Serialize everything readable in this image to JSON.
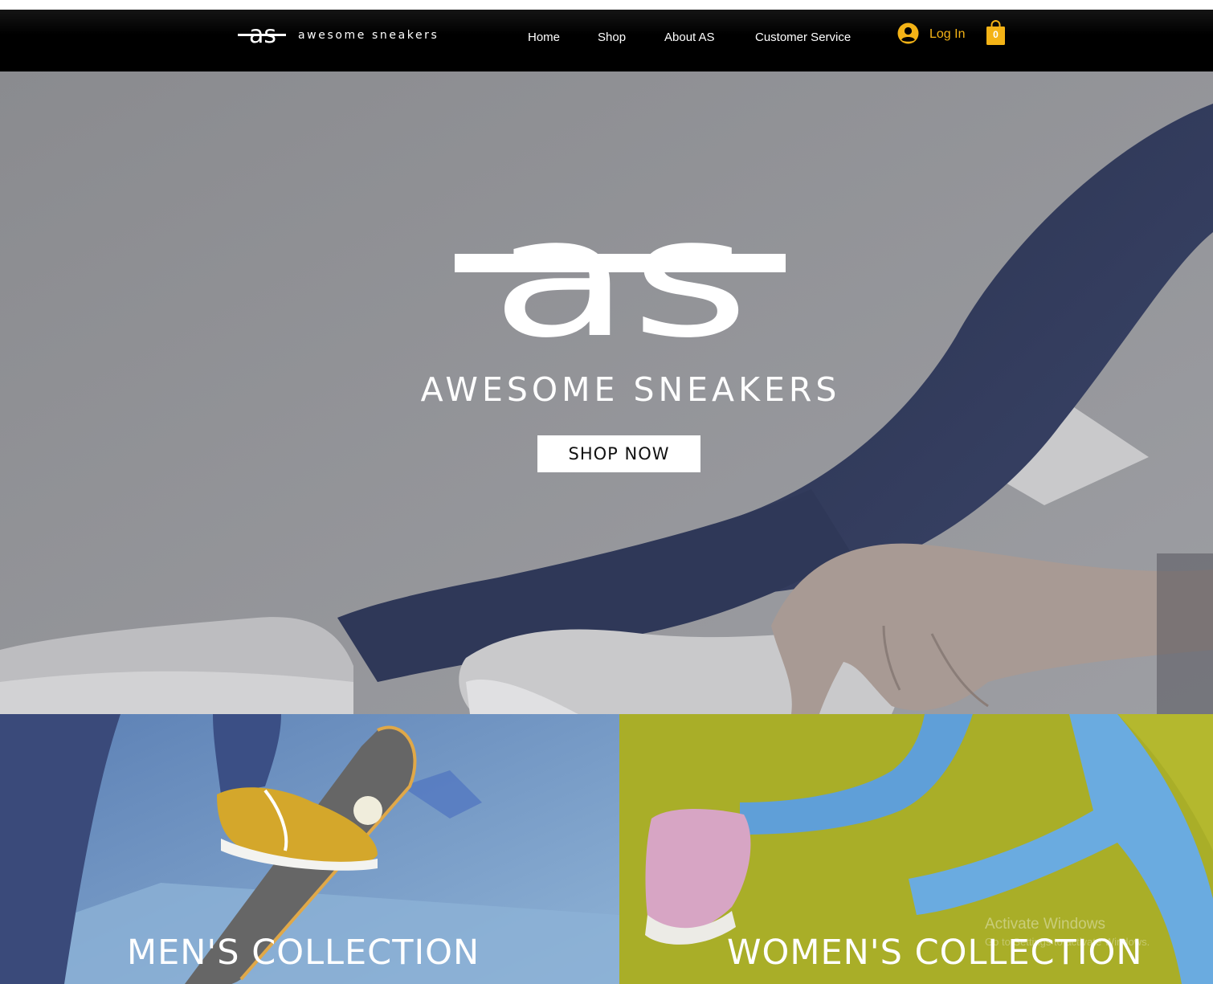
{
  "header": {
    "brand_name": "awesome sneakers",
    "logo_icon": "as-monogram-logo",
    "nav": [
      {
        "label": "Home"
      },
      {
        "label": "Shop"
      },
      {
        "label": "About AS"
      },
      {
        "label": "Customer Service"
      }
    ],
    "login": {
      "label": "Log In",
      "icon": "user-avatar-icon"
    },
    "cart": {
      "count": "0",
      "icon": "shopping-bag-icon"
    }
  },
  "hero": {
    "logo_icon": "as-monogram-logo",
    "title": "AWESOME SNEAKERS",
    "cta_label": "SHOP NOW",
    "image": "person-in-jeans-tying-white-sneakers"
  },
  "collections": [
    {
      "title": "MEN'S COLLECTION",
      "image": "skateboard-yellow-sneaker"
    },
    {
      "title": "WOMEN'S COLLECTION",
      "image": "running-legs-pink-sneaker"
    }
  ],
  "os_watermark": {
    "title": "Activate Windows",
    "subtitle": "Go to Settings to activate Windows."
  },
  "colors": {
    "header_bg": "#000000",
    "accent": "#f4b316",
    "hero_overlay": "#8c8d92",
    "men_bg": "#6b8fbd",
    "women_bg": "#a8ad2a"
  }
}
